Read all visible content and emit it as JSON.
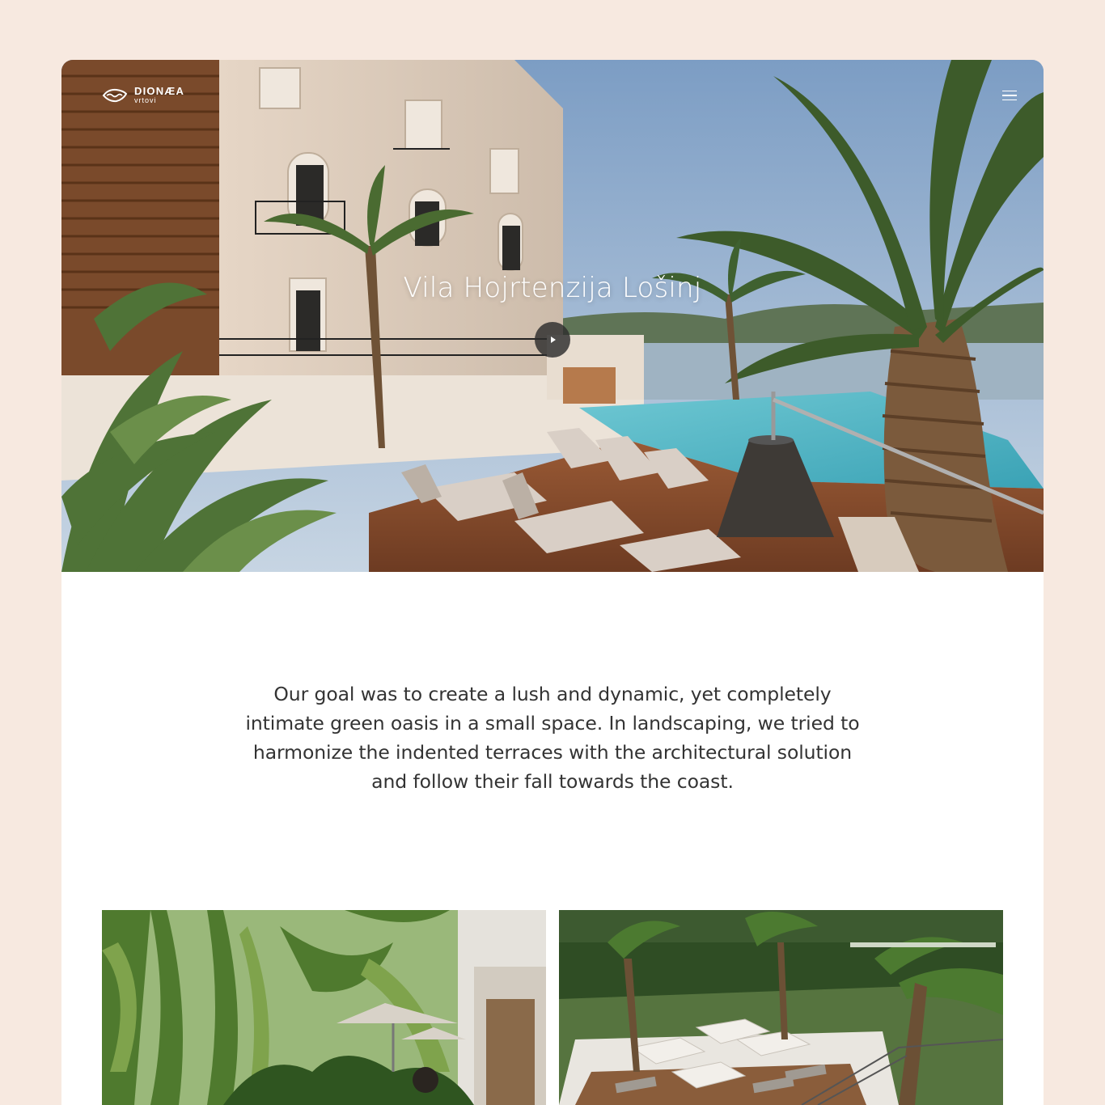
{
  "brand": {
    "name": "DIONÆA",
    "sub": "vrtovi",
    "logo_icon": "fish-wave-icon"
  },
  "header": {
    "menu_icon": "hamburger-menu-icon"
  },
  "hero": {
    "title": "Vila Hojrtenzija Lošinj",
    "play_icon": "play-icon",
    "image_alt": "Villa facade with terraced garden, palm trees, sun loungers and infinity pool by the sea"
  },
  "intro": {
    "text": "Our goal was to create a lush and dynamic, yet completely intimate green oasis in a small space. In landscaping, we tried to harmonize the indented terraces with the architectural solution and follow their fall towards the coast."
  },
  "gallery": [
    {
      "alt": "Lush garden with palms and umbrellas beside the villa"
    },
    {
      "alt": "Aerial view of terraced garden with umbrellas and loungers"
    }
  ],
  "colors": {
    "page_background": "#f7e9e0",
    "card_background": "#ffffff",
    "text": "#333333",
    "hero_text": "#ffffff"
  }
}
